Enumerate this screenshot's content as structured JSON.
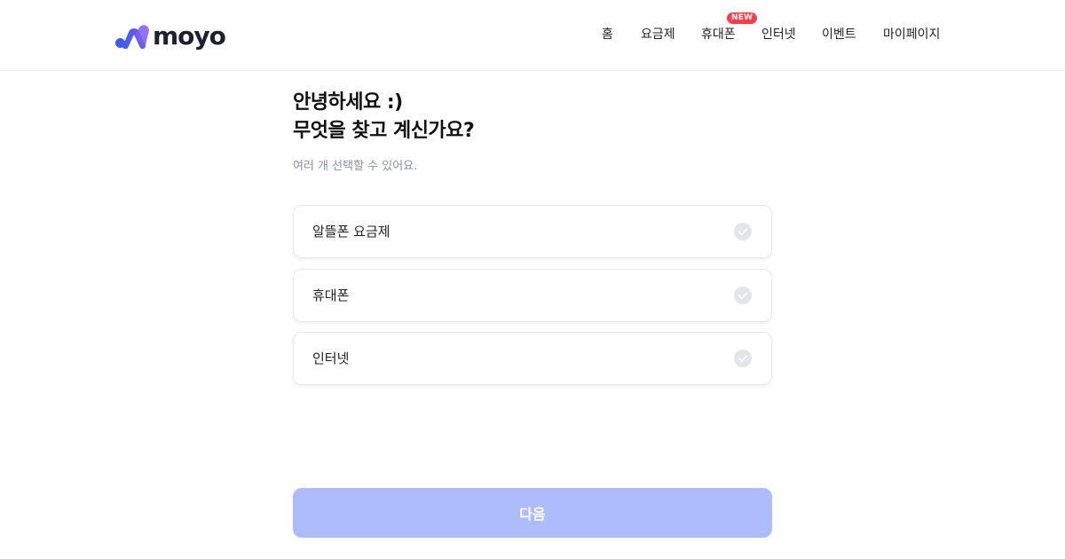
{
  "brand": {
    "name": "moyo",
    "accent": "#5a6df5",
    "dark": "#1f1f2e"
  },
  "nav": {
    "items": [
      {
        "label": "홈"
      },
      {
        "label": "요금제"
      },
      {
        "label": "휴대폰",
        "badge": "NEW"
      },
      {
        "label": "인터넷"
      },
      {
        "label": "이벤트"
      },
      {
        "label": "마이페이지"
      }
    ],
    "badge_color": "#ff3d4a"
  },
  "main": {
    "greeting_line1": "안녕하세요 :)",
    "greeting_line2": "무엇을 찾고 계신가요?",
    "subtext": "여러 개 선택할 수 있어요.",
    "options": [
      {
        "label": "알뜰폰 요금제",
        "selected": false
      },
      {
        "label": "휴대폰",
        "selected": false
      },
      {
        "label": "인터넷",
        "selected": false
      }
    ],
    "next_button": {
      "label": "다음",
      "enabled": false,
      "color": "#aebcfb"
    }
  },
  "icons": {
    "option_check": "check-circle-icon"
  }
}
